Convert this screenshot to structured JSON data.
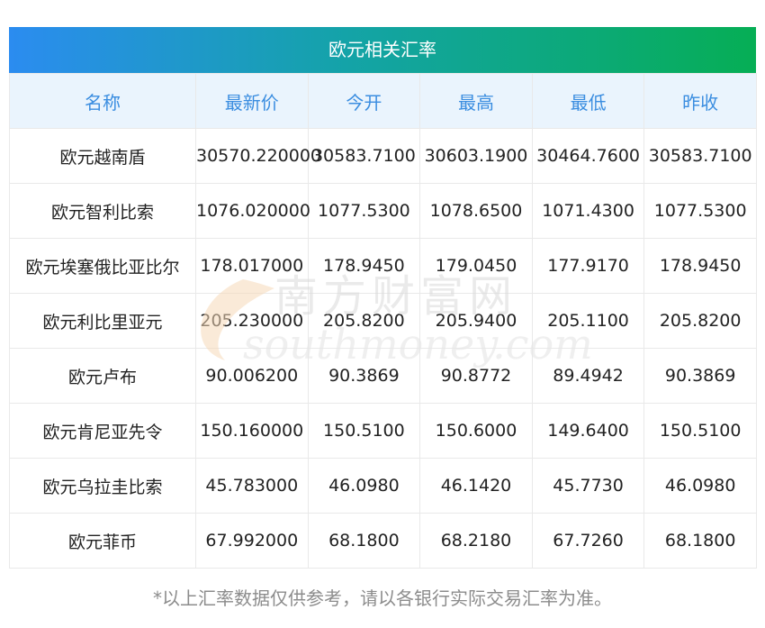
{
  "title": "欧元相关汇率",
  "headers": [
    "名称",
    "最新价",
    "今开",
    "最高",
    "最低",
    "昨收"
  ],
  "rows": [
    {
      "name": "欧元越南盾",
      "latest": "30570.220000",
      "open": "30583.7100",
      "high": "30603.1900",
      "low": "30464.7600",
      "prev_close": "30583.7100"
    },
    {
      "name": "欧元智利比索",
      "latest": "1076.020000",
      "open": "1077.5300",
      "high": "1078.6500",
      "low": "1071.4300",
      "prev_close": "1077.5300"
    },
    {
      "name": "欧元埃塞俄比亚比尔",
      "latest": "178.017000",
      "open": "178.9450",
      "high": "179.0450",
      "low": "177.9170",
      "prev_close": "178.9450"
    },
    {
      "name": "欧元利比里亚元",
      "latest": "205.230000",
      "open": "205.8200",
      "high": "205.9400",
      "low": "205.1100",
      "prev_close": "205.8200"
    },
    {
      "name": "欧元卢布",
      "latest": "90.006200",
      "open": "90.3869",
      "high": "90.8772",
      "low": "89.4942",
      "prev_close": "90.3869"
    },
    {
      "name": "欧元肯尼亚先令",
      "latest": "150.160000",
      "open": "150.5100",
      "high": "150.6000",
      "low": "149.6400",
      "prev_close": "150.5100"
    },
    {
      "name": "欧元乌拉圭比索",
      "latest": "45.783000",
      "open": "46.0980",
      "high": "46.1420",
      "low": "45.7730",
      "prev_close": "46.0980"
    },
    {
      "name": "欧元菲币",
      "latest": "67.992000",
      "open": "68.1800",
      "high": "68.2180",
      "low": "67.7260",
      "prev_close": "68.1800"
    }
  ],
  "watermark": {
    "cn": "南方财富网",
    "en": "southmoney.com"
  },
  "footnote": "*以上汇率数据仅供参考，请以各银行实际交易汇率为准。",
  "colors": {
    "title_gradient_start": "#2b8cf0",
    "title_gradient_end": "#06ae55",
    "header_bg": "#eaf4fd",
    "header_text": "#3a8de0",
    "footnote_text": "#8c8c8c"
  }
}
